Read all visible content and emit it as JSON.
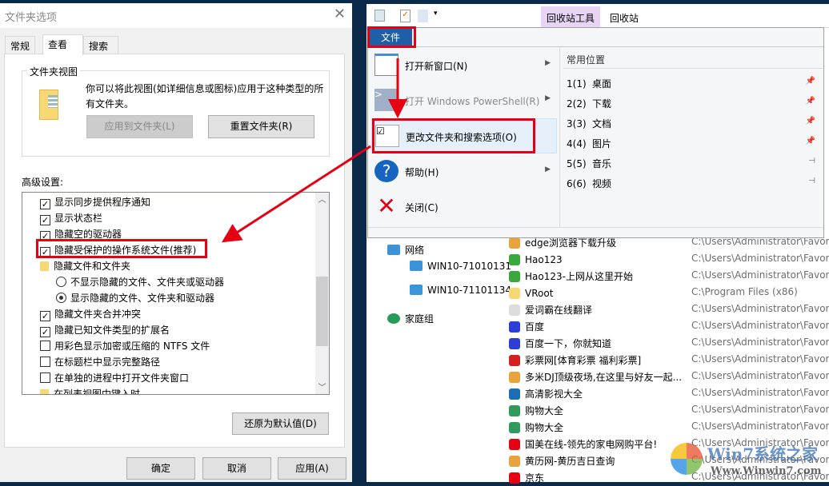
{
  "dialog": {
    "title": "文件夹选项",
    "tabs": [
      "常规",
      "查看",
      "搜索"
    ],
    "active_tab": "查看",
    "folder_view": {
      "label": "文件夹视图",
      "description": "你可以将此视图(如详细信息或图标)应用于这种类型的所有文件夹。",
      "apply_button": "应用到文件夹(L)",
      "reset_button": "重置文件夹(R)"
    },
    "advanced_label": "高级设置:",
    "settings": [
      {
        "type": "checkbox",
        "checked": true,
        "label": "显示同步提供程序通知"
      },
      {
        "type": "checkbox",
        "checked": true,
        "label": "显示状态栏"
      },
      {
        "type": "checkbox",
        "checked": true,
        "label": "隐藏空的驱动器"
      },
      {
        "type": "checkbox",
        "checked": true,
        "label": "隐藏受保护的操作系统文件(推荐)"
      },
      {
        "type": "folder",
        "label": "隐藏文件和文件夹"
      },
      {
        "type": "radio",
        "checked": false,
        "label": "不显示隐藏的文件、文件夹或驱动器"
      },
      {
        "type": "radio",
        "checked": true,
        "label": "显示隐藏的文件、文件夹和驱动器"
      },
      {
        "type": "checkbox",
        "checked": true,
        "label": "隐藏文件夹合并冲突"
      },
      {
        "type": "checkbox",
        "checked": true,
        "label": "隐藏已知文件类型的扩展名"
      },
      {
        "type": "checkbox",
        "checked": false,
        "label": "用彩色显示加密或压缩的 NTFS 文件"
      },
      {
        "type": "checkbox",
        "checked": false,
        "label": "在标题栏中显示完整路径"
      },
      {
        "type": "checkbox",
        "checked": false,
        "label": "在单独的进程中打开文件夹窗口"
      },
      {
        "type": "folder",
        "label": "在列表视图中键入时"
      }
    ],
    "restore_button": "还原为默认值(D)",
    "ok_button": "确定",
    "cancel_button": "取消",
    "apply_button": "应用(A)"
  },
  "explorer": {
    "ribbon_tabs": {
      "tools": "回收站工具",
      "recycle": "回收站"
    },
    "file_tab": "文件",
    "file_menu": [
      {
        "label": "打开新窗口(N)",
        "submenu": true,
        "disabled": false
      },
      {
        "label": "打开 Windows PowerShell(R)",
        "submenu": true,
        "disabled": true
      },
      {
        "label": "更改文件夹和搜索选项(O)",
        "submenu": false,
        "disabled": false
      },
      {
        "label": "帮助(H)",
        "submenu": true,
        "disabled": false
      },
      {
        "label": "关闭(C)",
        "submenu": false,
        "disabled": false
      }
    ],
    "frequent_title": "常用位置",
    "frequent": [
      {
        "key": "1(1)",
        "name": "桌面",
        "pinned": true
      },
      {
        "key": "2(2)",
        "name": "下载",
        "pinned": true
      },
      {
        "key": "3(3)",
        "name": "文档",
        "pinned": true
      },
      {
        "key": "4(4)",
        "name": "图片",
        "pinned": true
      },
      {
        "key": "5(5)",
        "name": "音乐",
        "pinned": false
      },
      {
        "key": "6(6)",
        "name": "视频",
        "pinned": false
      }
    ],
    "nav": [
      "网络",
      "WIN10-71010131",
      "WIN10-71101134",
      "家庭组"
    ],
    "files": [
      {
        "name": "edge浏览器下载升级",
        "path": "C:\\Users\\Administrator\\Favori",
        "color": "#e8a33b"
      },
      {
        "name": "Hao123",
        "path": "C:\\Users\\Administrator\\Favori",
        "color": "#3aa83a"
      },
      {
        "name": "Hao123-上网从这里开始",
        "path": "C:\\Users\\Administrator\\Favori",
        "color": "#3aa83a"
      },
      {
        "name": "VRoot",
        "path": "C:\\Program Files (x86)",
        "color": "#f8d775"
      },
      {
        "name": "爱词霸在线翻译",
        "path": "C:\\Users\\Administrator\\Favori",
        "color": "#dddddd"
      },
      {
        "name": "百度",
        "path": "C:\\Users\\Administrator\\Favori",
        "color": "#2b3fd6"
      },
      {
        "name": "百度一下，你就知道",
        "path": "C:\\Users\\Administrator\\Favori",
        "color": "#2b3fd6"
      },
      {
        "name": "彩票网[体育彩票 福利彩票]",
        "path": "C:\\Users\\Administrator\\Favori",
        "color": "#d52020"
      },
      {
        "name": "多米DJ顶级夜场,在这里与好友一起...",
        "path": "C:\\Users\\Administrator\\Favori",
        "color": "#e8a33b"
      },
      {
        "name": "高清影视大全",
        "path": "C:\\Users\\Administrator\\Favori",
        "color": "#1a6fb5"
      },
      {
        "name": "购物大全",
        "path": "C:\\Users\\Administrator\\Favori",
        "color": "#2f9a5c"
      },
      {
        "name": "购物大全",
        "path": "C:\\Users\\Administrator\\Favori",
        "color": "#2f9a5c"
      },
      {
        "name": "国美在线-领先的家电网购平台!",
        "path": "C:\\Users\\Administrator\\Favori",
        "color": "#e60012"
      },
      {
        "name": "黄历网-黄历吉日查询",
        "path": "C:\\Users\\Administrator\\Favori",
        "color": "#e8a33b"
      },
      {
        "name": "京东",
        "path": "C:\\Users\\Administrator\\Favori",
        "color": "#e60012"
      }
    ]
  },
  "watermark": {
    "text": "Win7系统之家",
    "url": "Www.Winwin7.com"
  },
  "colors": {
    "highlight": "#e60012",
    "file_tab": "#1e5fa8",
    "tools_tab": "#e8d5f5"
  }
}
